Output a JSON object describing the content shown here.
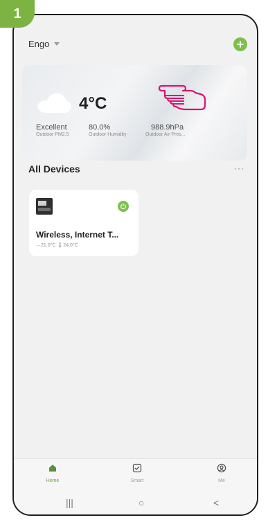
{
  "step_number": "1",
  "header": {
    "home_name": "Engo"
  },
  "weather": {
    "temperature": "4°C",
    "metrics": [
      {
        "value": "Excellent",
        "label": "Outdoor PM2.5"
      },
      {
        "value": "80.0%",
        "label": "Outdoor Humidity"
      },
      {
        "value": "988.9hPa",
        "label": "Outdoor Air Pres..."
      }
    ]
  },
  "devices_section": {
    "title": "All Devices",
    "more": "···"
  },
  "device": {
    "name": "Wireless, Internet T...",
    "temps": "↔21.0°C  🌡24.0°C"
  },
  "bottom_nav": [
    {
      "label": "Home",
      "icon": "home-icon"
    },
    {
      "label": "Smart",
      "icon": "smart-checkbox-icon"
    },
    {
      "label": "Me",
      "icon": "profile-icon"
    }
  ],
  "system_nav": {
    "recents": "|||",
    "home": "○",
    "back": "<"
  },
  "colors": {
    "accent_green": "#7cc04b",
    "step_badge": "#7cb342",
    "pointer_hand": "#d8146f"
  }
}
